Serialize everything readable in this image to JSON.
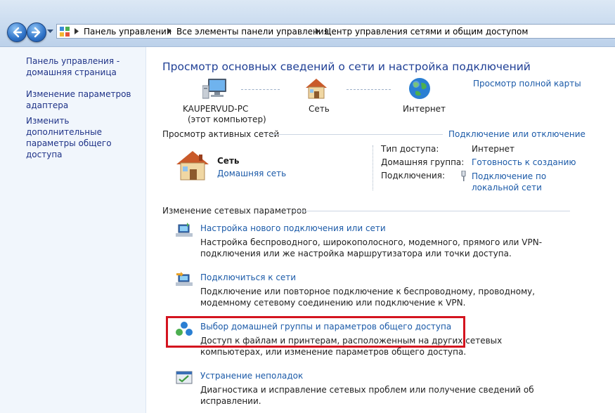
{
  "address_bar": {
    "crumbs": [
      "Панель управления",
      "Все элементы панели управления",
      "Центр управления сетями и общим доступом"
    ]
  },
  "sidebar": {
    "items": [
      {
        "label": "Панель управления - домашняя страница"
      },
      {
        "label": "Изменение параметров адаптера"
      },
      {
        "label": "Изменить дополнительные параметры общего доступа"
      }
    ]
  },
  "main": {
    "title": "Просмотр основных сведений о сети и настройка подключений",
    "full_map_link": "Просмотр полной карты",
    "map": {
      "computer_name": "KAUPERVUD-PC",
      "computer_sub": "(этот компьютер)",
      "network": "Сеть",
      "internet": "Интернет"
    },
    "active_networks": {
      "heading": "Просмотр активных сетей",
      "connect_link": "Подключение или отключение",
      "network_name": "Сеть",
      "network_type_link": "Домашняя сеть",
      "access_type_label": "Тип доступа:",
      "access_type_value": "Интернет",
      "homegroup_label": "Домашняя группа:",
      "homegroup_value": "Готовность к созданию",
      "connections_label": "Подключения:",
      "connections_value": "Подключение по локальной сети"
    },
    "change_settings": {
      "heading": "Изменение сетевых параметров",
      "tasks": [
        {
          "title": "Настройка нового подключения или сети",
          "description": "Настройка беспроводного, широкополосного, модемного, прямого или VPN-подключения или же настройка маршрутизатора или точки доступа."
        },
        {
          "title": "Подключиться к сети",
          "description": "Подключение или повторное подключение к беспроводному, проводному, модемному сетевому соединению или подключение к VPN."
        },
        {
          "title": "Выбор домашней группы и параметров общего доступа",
          "description": "Доступ к файлам и принтерам, расположенным на других сетевых компьютерах, или изменение параметров общего доступа."
        },
        {
          "title": "Устранение неполадок",
          "description": "Диагностика и исправление сетевых проблем или получение сведений об исправлении."
        }
      ]
    }
  },
  "highlight_color": "#d4141f"
}
